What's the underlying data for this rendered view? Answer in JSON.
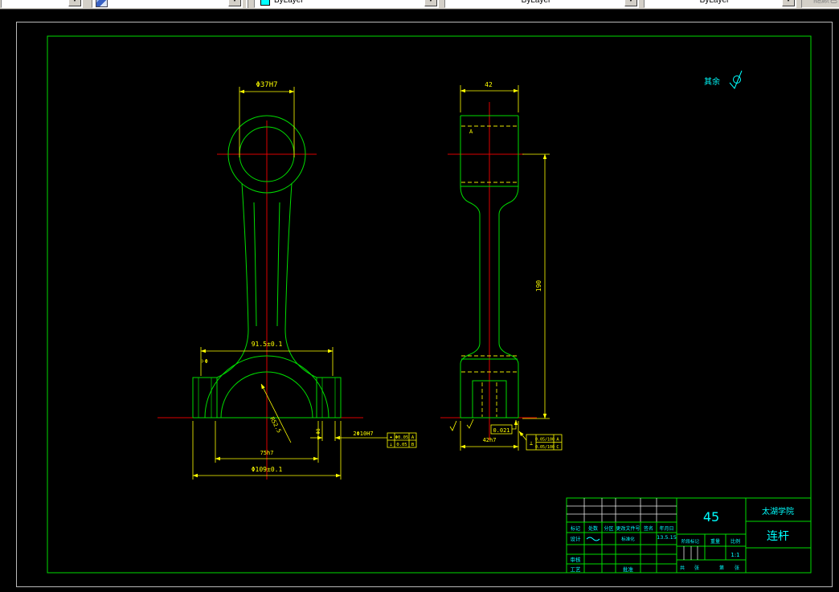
{
  "toolbar": {
    "color_value": "ByLayer",
    "linetype_value": "ByLayer",
    "lineweight_value": "ByLayer",
    "plot_style_value": "随颜色"
  },
  "notes": {
    "rest_label": "其余"
  },
  "front_view": {
    "dim_small_bore": "Φ37H7",
    "dim_span": "91.5±0.1",
    "dim_radius": "R52.5",
    "dim_cap_width": "75h7",
    "dim_big_od": "Φ109±0.1",
    "dim_bolt_holes": "2Φ10H7",
    "dim_tab_hole": "Φ8",
    "section_mark": "⊦Φ",
    "fcf": {
      "r1_sym": "⌖",
      "r1_tol": "Φ0.05",
      "r1_datum": "A",
      "r2_sym": "⊥",
      "r2_tol": "0.05",
      "r2_datum": "B"
    }
  },
  "side_view": {
    "dim_width_top": "42",
    "dim_length": "190",
    "dim_width_bottom": "42h7",
    "dim_boxed": "0.021",
    "datum_a": "A",
    "fcf": {
      "sym": "⊥",
      "r1_tol": "0.05/100",
      "r1_datum": "A",
      "r2_tol": "0.05/100",
      "r2_datum": "C"
    }
  },
  "title_block": {
    "material": "45",
    "company": "太湖学院",
    "part_name": "连杆",
    "date": "13.5.15",
    "scale_value": "1:1",
    "h_mark": "标记",
    "h_count": "处数",
    "h_zone": "分区",
    "h_doc": "更改文件号",
    "h_sign": "签名",
    "h_date": "年月日",
    "r_design": "设计",
    "r_standard": "标准化",
    "r_check": "审核",
    "r_process": "工艺",
    "r_approve": "批准",
    "stage_label": "阶段标记",
    "weight_label": "重量",
    "scale_label": "比例",
    "sheet_total": "共",
    "sheet_unit1": "张",
    "sheet_no": "第",
    "sheet_unit2": "张"
  }
}
